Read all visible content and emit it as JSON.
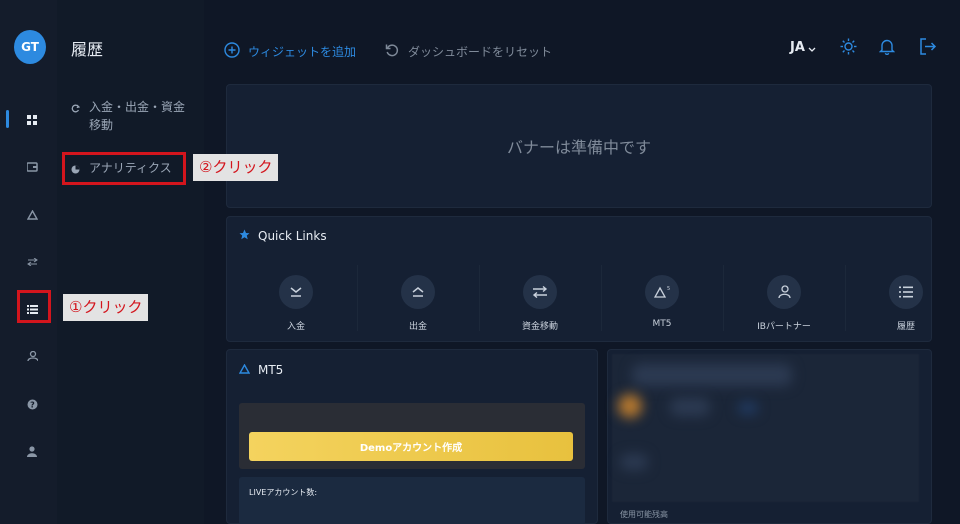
{
  "app": {
    "logo_text": "GT"
  },
  "rail": {
    "items": [
      {
        "name": "dashboard-icon"
      },
      {
        "name": "wallet-icon"
      },
      {
        "name": "mt5-icon"
      },
      {
        "name": "transfer-icon"
      },
      {
        "name": "history-list-icon"
      },
      {
        "name": "ib-partner-icon"
      },
      {
        "name": "help-icon"
      },
      {
        "name": "user-icon"
      }
    ]
  },
  "subnav": {
    "title": "履歴",
    "items": [
      {
        "label": "入金・出金・資金\n移動",
        "line1": "入金・出金・資金",
        "line2": "移動"
      },
      {
        "label": "アナリティクス"
      }
    ]
  },
  "topbar": {
    "add_widget": "ウィジェットを追加",
    "reset_dashboard": "ダッシュボードをリセット",
    "language": "JA"
  },
  "banner": {
    "text": "バナーは準備中です"
  },
  "quick_links": {
    "title": "Quick Links",
    "items": [
      {
        "label": "入金"
      },
      {
        "label": "出金"
      },
      {
        "label": "資金移動"
      },
      {
        "label": "MT5"
      },
      {
        "label": "IBパートナー"
      },
      {
        "label": "履歴"
      }
    ]
  },
  "mt5": {
    "title": "MT5",
    "demo_button": "Demoアカウント作成",
    "live_label": "LIVEアカウント数:"
  },
  "balance": {
    "label": "使用可能残高"
  },
  "annotations": {
    "step1": "①クリック",
    "step2": "②クリック"
  },
  "colors": {
    "accent": "#2d8ae0",
    "annotation": "#d3151d",
    "demo_button": "#f0cf52"
  }
}
